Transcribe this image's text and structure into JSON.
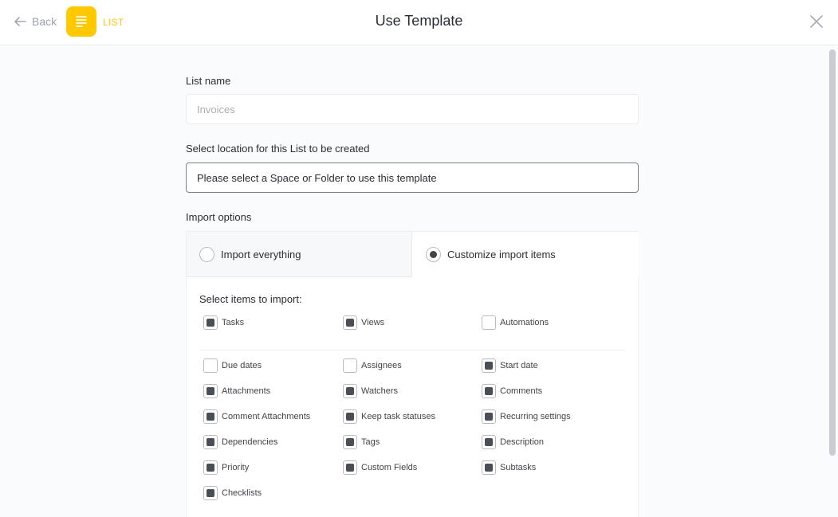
{
  "header": {
    "back_label": "Back",
    "type_label": "LIST",
    "title": "Use Template"
  },
  "form": {
    "list_name_label": "List name",
    "list_name_placeholder": "Invoices",
    "list_name_value": "",
    "location_label": "Select location for this List to be created",
    "location_value": "Please select a Space or Folder to use this template",
    "import_label": "Import options",
    "import_tabs": [
      {
        "label": "Import everything",
        "selected": false
      },
      {
        "label": "Customize import items",
        "selected": true
      }
    ],
    "select_items_label": "Select items to import:"
  },
  "items": [
    {
      "label": "Tasks",
      "checked": true
    },
    {
      "label": "Views",
      "checked": true
    },
    {
      "label": "Automations",
      "checked": false
    },
    {
      "label": "Due dates",
      "checked": false
    },
    {
      "label": "Assignees",
      "checked": false
    },
    {
      "label": "Start date",
      "checked": true
    },
    {
      "label": "Attachments",
      "checked": true
    },
    {
      "label": "Watchers",
      "checked": true
    },
    {
      "label": "Comments",
      "checked": true
    },
    {
      "label": "Comment Attachments",
      "checked": true
    },
    {
      "label": "Keep task statuses",
      "checked": true
    },
    {
      "label": "Recurring settings",
      "checked": true
    },
    {
      "label": "Dependencies",
      "checked": true
    },
    {
      "label": "Tags",
      "checked": true
    },
    {
      "label": "Description",
      "checked": true
    },
    {
      "label": "Priority",
      "checked": true
    },
    {
      "label": "Custom Fields",
      "checked": true
    },
    {
      "label": "Subtasks",
      "checked": true
    },
    {
      "label": "Checklists",
      "checked": true
    }
  ],
  "colors": {
    "accent": "#ffc800",
    "checked_fill": "#4a4e55"
  },
  "icons": {
    "back": "arrow-left-icon",
    "list": "list-document-icon",
    "close": "close-icon"
  }
}
